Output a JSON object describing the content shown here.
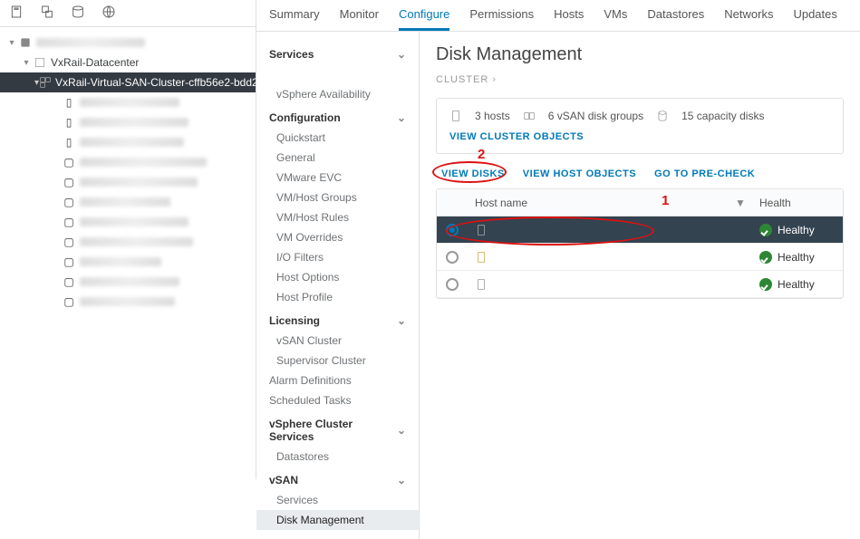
{
  "iconbar": [
    "hosts-icon",
    "vms-icon",
    "storage-icon",
    "networks-icon"
  ],
  "tree": {
    "datacenter": "VxRail-Datacenter",
    "cluster": "VxRail-Virtual-SAN-Cluster-cffb56e2-bdd2..."
  },
  "tabs": [
    "Summary",
    "Monitor",
    "Configure",
    "Permissions",
    "Hosts",
    "VMs",
    "Datastores",
    "Networks",
    "Updates"
  ],
  "activeTab": "Configure",
  "config": {
    "groups": [
      {
        "label": "Services",
        "items": [
          "",
          "vSphere Availability"
        ]
      },
      {
        "label": "Configuration",
        "items": [
          "Quickstart",
          "General",
          "VMware EVC",
          "VM/Host Groups",
          "VM/Host Rules",
          "VM Overrides",
          "I/O Filters",
          "Host Options",
          "Host Profile"
        ]
      },
      {
        "label": "Licensing",
        "items": [
          "vSAN Cluster",
          "Supervisor Cluster"
        ]
      },
      {
        "label": "",
        "plainItems": [
          "Alarm Definitions",
          "Scheduled Tasks"
        ]
      },
      {
        "label": "vSphere Cluster Services",
        "items": [
          "Datastores"
        ]
      },
      {
        "label": "vSAN",
        "items": [
          "Services",
          "Disk Management",
          ""
        ]
      }
    ],
    "selected": "Disk Management"
  },
  "detail": {
    "title": "Disk Management",
    "breadcrumb": "CLUSTER",
    "stats": {
      "hosts": "3 hosts",
      "diskGroups": "6 vSAN disk groups",
      "capDisks": "15 capacity disks"
    },
    "viewClusterObjects": "VIEW CLUSTER OBJECTS",
    "actions": {
      "viewDisks": "VIEW DISKS",
      "viewHostObjects": "VIEW HOST OBJECTS",
      "goToPrecheck": "GO TO PRE-CHECK"
    },
    "table": {
      "headers": {
        "host": "Host name",
        "health": "Health"
      },
      "rows": [
        {
          "selected": true,
          "hostRedacted": true,
          "health": "Healthy"
        },
        {
          "selected": false,
          "hostRedacted": true,
          "health": "Healthy"
        },
        {
          "selected": false,
          "hostRedacted": true,
          "health": "Healthy"
        }
      ]
    }
  },
  "annotations": {
    "one": "1",
    "two": "2"
  }
}
